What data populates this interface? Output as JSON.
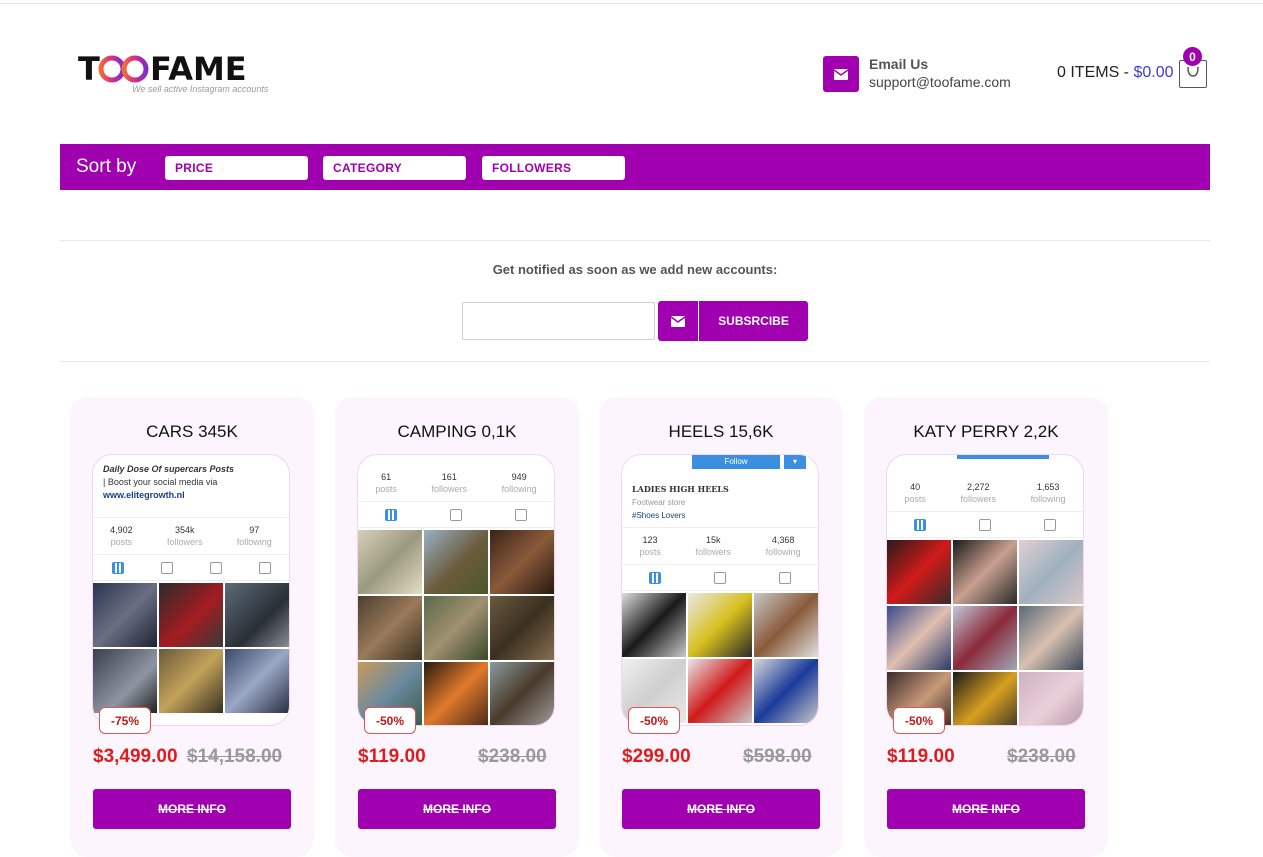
{
  "header": {
    "logo_text": "TOOFAME",
    "logo_tagline": "We sell active Instagram accounts",
    "email_label": "Email Us",
    "email_address": "support@toofame.com",
    "cart_items": "0 ITEMS - ",
    "cart_amount": "$0.00",
    "cart_count": "0"
  },
  "sort": {
    "label": "Sort by",
    "options": [
      "PRICE",
      "CATEGORY",
      "FOLLOWERS"
    ]
  },
  "subscribe": {
    "prompt": "Get notified as soon as we add new accounts:",
    "button": "SUBSRCIBE",
    "placeholder": ""
  },
  "colors": {
    "accent": "#a100b0",
    "sale": "#e01b1b"
  },
  "products": [
    {
      "title": "CARS 345K",
      "bio_line1": "Daily Dose Of supercars Posts",
      "bio_line2": "| Boost your social media via",
      "bio_line3": "www.elitegrowth.nl",
      "posts": "4,902",
      "followers": "354k",
      "following": "97",
      "discount": "-75%",
      "price": "$3,499.00",
      "old_price": "$14,158.00",
      "button": "MORE INFO"
    },
    {
      "title": "CAMPING 0,1K",
      "posts": "61",
      "followers": "161",
      "following": "949",
      "discount": "-50%",
      "price": "$119.00",
      "old_price": "$238.00",
      "button": "MORE INFO"
    },
    {
      "title": "HEELS 15,6K",
      "follow_label": "Follow",
      "bio_line1": "LADIES HIGH HEELS",
      "bio_line2": "Footwear store",
      "bio_line3": "#Shoes Lovers",
      "posts": "123",
      "followers": "15k",
      "following": "4,368",
      "discount": "-50%",
      "price": "$299.00",
      "old_price": "$598.00",
      "button": "MORE INFO"
    },
    {
      "title": "KATY PERRY 2,2K",
      "posts": "40",
      "followers": "2,272",
      "following": "1,653",
      "discount": "-50%",
      "price": "$119.00",
      "old_price": "$238.00",
      "button": "MORE INFO"
    }
  ],
  "stat_labels": {
    "posts": "posts",
    "followers": "followers",
    "following": "following"
  }
}
